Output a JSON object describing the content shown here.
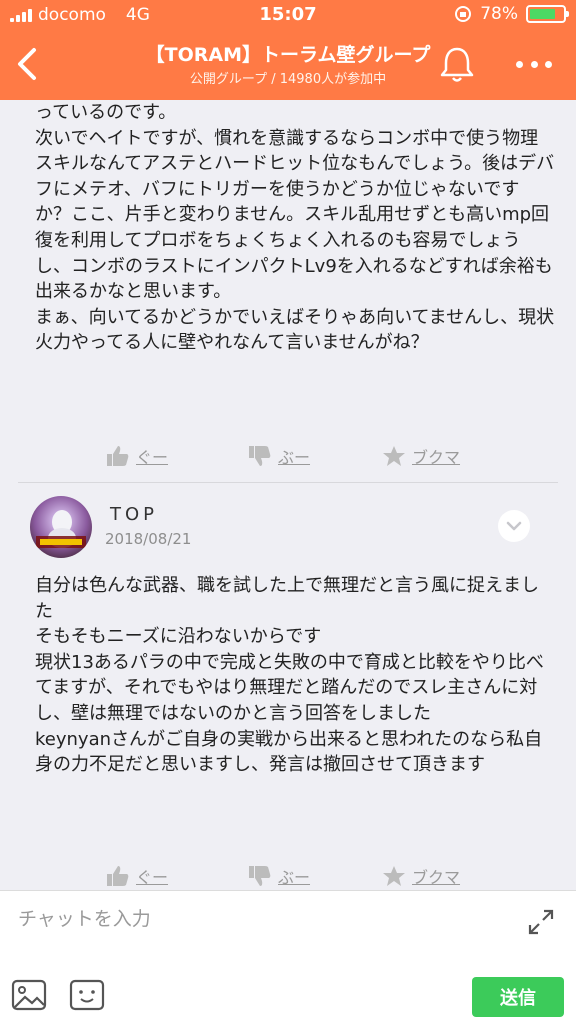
{
  "status_bar": {
    "carrier": "docomo",
    "network": "4G",
    "time": "15:07",
    "battery": "78%",
    "battery_level": 0.78
  },
  "nav": {
    "title": "【TORAM】トーラム壁グループ",
    "subtitle": "公開グループ / 14980人が参加中"
  },
  "post_previous": {
    "text": "っているのです。\n次いでヘイトですが、慣れを意識するならコンボ中で使う物理スキルなんてアステとハードヒット位なもんでしょう。後はデバフにメテオ、バフにトリガーを使うかどうか位じゃないですか？ここ、片手と変わりません。スキル乱用せずとも高いmp回復を利用してプロボをちょくちょく入れるのも容易でしょうし、コンボのラストにインパクトLv9を入れるなどすれば余裕も出来るかなと思います。\nまぁ、向いてるかどうかでいえばそりゃあ向いてませんし、現状火力やってる人に壁やれなんて言いませんがね？",
    "reactions": {
      "good": "ぐー",
      "boo": "ぶー",
      "bookmark": "ブクマ"
    }
  },
  "post_top": {
    "username": "TOP",
    "date": "2018/08/21",
    "text": "自分は色んな武器、職を試した上で無理だと言う風に捉えました\nそもそもニーズに沿わないからです\n現状13あるパラの中で完成と失敗の中で育成と比較をやり比べてますが、それでもやはり無理だと踏んだのでスレ主さんに対し、壁は無理ではないのかと言う回答をしました\nkeynyanさんがご自身の実戦から出来ると思われたのなら私自身の力不足だと思いますし、発言は撤回させて頂きます",
    "reactions": {
      "good": "ぐー",
      "boo": "ぶー",
      "bookmark": "ブクマ"
    }
  },
  "composer": {
    "placeholder": "チャットを入力",
    "send_label": "送信"
  },
  "colors": {
    "header": "#ff7a45",
    "send": "#3ccb5a",
    "background": "#efeff4"
  }
}
